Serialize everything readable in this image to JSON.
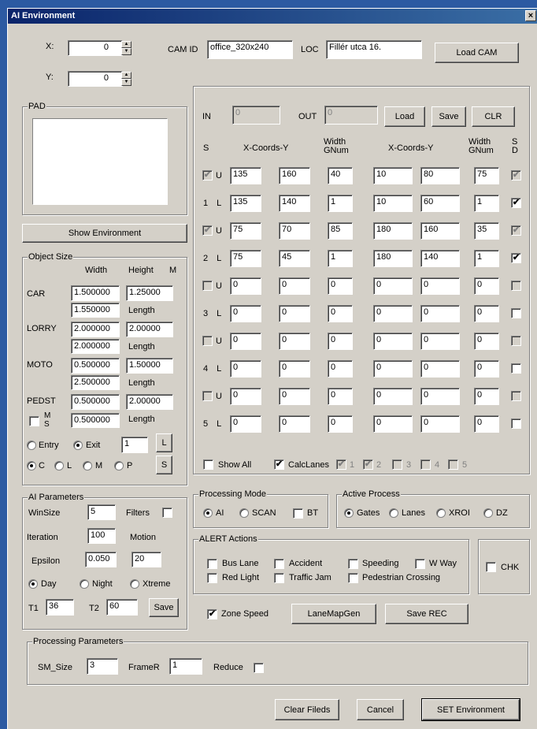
{
  "window": {
    "title": "AI Environment",
    "close": "×"
  },
  "top": {
    "x_label": "X:",
    "x_value": "0",
    "y_label": "Y:",
    "y_value": "0",
    "camid_label": "CAM ID",
    "camid_value": "office_320x240",
    "loc_label": "LOC",
    "loc_value": "Fillér utca 16.",
    "loadcam": "Load CAM"
  },
  "pad": {
    "title": "PAD"
  },
  "show_env": "Show Environment",
  "objsize": {
    "title": "Object Size",
    "width": "Width",
    "height": "Height",
    "m": "M",
    "length": "Length",
    "car": {
      "label": "CAR",
      "w": "1.500000",
      "h": "1.25000",
      "l": "1.550000"
    },
    "lorry": {
      "label": "LORRY",
      "w": "2.000000",
      "h": "2.00000",
      "l": "2.000000"
    },
    "moto": {
      "label": "MOTO",
      "w": "0.500000",
      "h": "1.50000",
      "l": "2.500000"
    },
    "pedst": {
      "label": "PEDST",
      "w": "0.500000",
      "h": "2.00000",
      "l": "0.500000"
    },
    "ms1": "M",
    "ms2": "S",
    "entry": "Entry",
    "exit": "Exit",
    "exit_val": "1",
    "l_btn": "L",
    "s_btn": "S",
    "c": "C",
    "l": "L",
    "p": "P"
  },
  "ai": {
    "title": "AI Parameters",
    "winsize": "WinSize",
    "winsize_v": "5",
    "filters": "Filters",
    "iteration": "Iteration",
    "iteration_v": "100",
    "motion": "Motion",
    "epsilon": "Epsilon",
    "epsilon_v": "0.050",
    "motion_v": "20",
    "day": "Day",
    "night": "Night",
    "xtreme": "Xtreme",
    "t1": "T1",
    "t1_v": "36",
    "t2": "T2",
    "t2_v": "60",
    "save": "Save"
  },
  "lanes": {
    "in": "IN",
    "in_v": "0",
    "out": "OUT",
    "out_v": "0",
    "load": "Load",
    "save": "Save",
    "clr": "CLR",
    "s": "S",
    "xy1": "X-Coords-Y",
    "width1": "Width",
    "gnum1": "GNum",
    "xy2": "X-Coords-Y",
    "width2": "Width",
    "gnum2": "GNum",
    "s2": "S",
    "d": "D",
    "rows": [
      {
        "lbl": "U",
        "a": "135",
        "b": "160",
        "c": "40",
        "d": "10",
        "e": "80",
        "f": "75"
      },
      {
        "lbl": "1 L",
        "a": "135",
        "b": "140",
        "c": "1",
        "d": "10",
        "e": "60",
        "f": "1"
      },
      {
        "lbl": "U",
        "a": "75",
        "b": "70",
        "c": "85",
        "d": "180",
        "e": "160",
        "f": "35"
      },
      {
        "lbl": "2 L",
        "a": "75",
        "b": "45",
        "c": "1",
        "d": "180",
        "e": "140",
        "f": "1"
      },
      {
        "lbl": "U",
        "a": "0",
        "b": "0",
        "c": "0",
        "d": "0",
        "e": "0",
        "f": "0"
      },
      {
        "lbl": "3 L",
        "a": "0",
        "b": "0",
        "c": "0",
        "d": "0",
        "e": "0",
        "f": "0"
      },
      {
        "lbl": "U",
        "a": "0",
        "b": "0",
        "c": "0",
        "d": "0",
        "e": "0",
        "f": "0"
      },
      {
        "lbl": "4 L",
        "a": "0",
        "b": "0",
        "c": "0",
        "d": "0",
        "e": "0",
        "f": "0"
      },
      {
        "lbl": "U",
        "a": "0",
        "b": "0",
        "c": "0",
        "d": "0",
        "e": "0",
        "f": "0"
      },
      {
        "lbl": "5 L",
        "a": "0",
        "b": "0",
        "c": "0",
        "d": "0",
        "e": "0",
        "f": "0"
      }
    ],
    "showall": "Show All",
    "calclanes": "CalcLanes",
    "n1": "1",
    "n2": "2",
    "n3": "3",
    "n4": "4",
    "n5": "5"
  },
  "proc": {
    "title": "Processing Mode",
    "ai": "AI",
    "scan": "SCAN",
    "bt": "BT"
  },
  "active": {
    "title": "Active Process",
    "gates": "Gates",
    "lanes": "Lanes",
    "xroi": "XROI",
    "dz": "DZ"
  },
  "alert": {
    "title": "ALERT Actions",
    "bus": "Bus Lane",
    "accident": "Accident",
    "speeding": "Speeding",
    "wway": "W Way",
    "red": "Red Light",
    "traffic": "Traffic Jam",
    "ped": "Pedestrian Crossing"
  },
  "chk": "CHK",
  "zone": "Zone Speed",
  "lanemap": "LaneMapGen",
  "saverec": "Save REC",
  "pp": {
    "title": "Processing Parameters",
    "sm": "SM_Size",
    "sm_v": "3",
    "framer": "FrameR",
    "framer_v": "1",
    "reduce": "Reduce"
  },
  "bottom": {
    "clear": "Clear Fileds",
    "cancel": "Cancel",
    "set": "SET Environment"
  }
}
